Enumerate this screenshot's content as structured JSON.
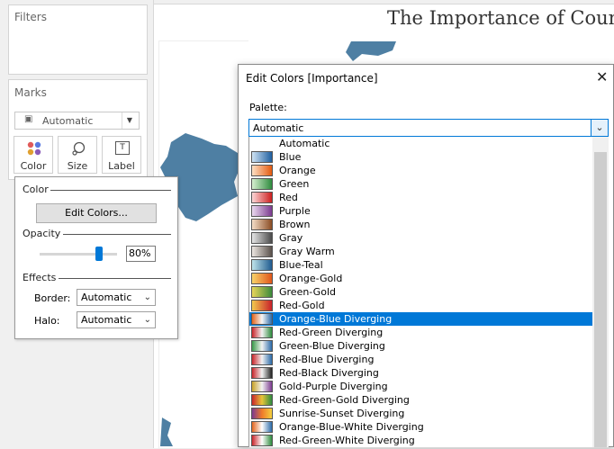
{
  "left_panel": {
    "filters_label": "Filters",
    "marks_label": "Marks",
    "mark_type": "Automatic",
    "mark_buttons": [
      {
        "label": "Color",
        "icon": "color-dots-icon"
      },
      {
        "label": "Size",
        "icon": "size-icon"
      },
      {
        "label": "Label",
        "icon": "label-icon"
      }
    ]
  },
  "canvas": {
    "title": "The Importance of Coun"
  },
  "color_popup": {
    "color_section": "Color",
    "edit_colors_button": "Edit Colors...",
    "opacity_section": "Opacity",
    "opacity_value": "80%",
    "opacity_fraction": 0.8,
    "effects_section": "Effects",
    "border_label": "Border:",
    "border_value": "Automatic",
    "halo_label": "Halo:",
    "halo_value": "Automatic"
  },
  "dialog": {
    "title": "Edit Colors [Importance]",
    "palette_label": "Palette:",
    "palette_value": "Automatic",
    "selected_index": 13,
    "palettes": [
      {
        "name": "Automatic",
        "colors": []
      },
      {
        "name": "Blue",
        "colors": [
          "#cfe3f4",
          "#1f5fa0"
        ]
      },
      {
        "name": "Orange",
        "colors": [
          "#fde0c5",
          "#e35a0f"
        ]
      },
      {
        "name": "Green",
        "colors": [
          "#d6efd0",
          "#2e8b3e"
        ]
      },
      {
        "name": "Red",
        "colors": [
          "#fcd7d7",
          "#cc1f1f"
        ]
      },
      {
        "name": "Purple",
        "colors": [
          "#ead9ef",
          "#7b3a8f"
        ]
      },
      {
        "name": "Brown",
        "colors": [
          "#f3dcc6",
          "#8a4c24"
        ]
      },
      {
        "name": "Gray",
        "colors": [
          "#e6e6e6",
          "#4a4a4a"
        ]
      },
      {
        "name": "Gray Warm",
        "colors": [
          "#ece6e1",
          "#5a514b"
        ]
      },
      {
        "name": "Blue-Teal",
        "colors": [
          "#bfe3ea",
          "#1f5b8f"
        ]
      },
      {
        "name": "Orange-Gold",
        "colors": [
          "#f8d36a",
          "#e0561a"
        ]
      },
      {
        "name": "Green-Gold",
        "colors": [
          "#e8d65a",
          "#3a8a3a"
        ]
      },
      {
        "name": "Red-Gold",
        "colors": [
          "#f2c94c",
          "#c8202a"
        ]
      },
      {
        "name": "Orange-Blue Diverging",
        "colors": [
          "#e3651d",
          "#f6f6f6",
          "#2b6aa8"
        ]
      },
      {
        "name": "Red-Green Diverging",
        "colors": [
          "#c8252a",
          "#f2f2f2",
          "#2e8b3e"
        ]
      },
      {
        "name": "Green-Blue Diverging",
        "colors": [
          "#3a9a4a",
          "#f2f2f2",
          "#2b6aa8"
        ]
      },
      {
        "name": "Red-Blue Diverging",
        "colors": [
          "#c8252a",
          "#f2f2f2",
          "#2b6aa8"
        ]
      },
      {
        "name": "Red-Black Diverging",
        "colors": [
          "#c8252a",
          "#f2f2f2",
          "#222222"
        ]
      },
      {
        "name": "Gold-Purple Diverging",
        "colors": [
          "#c9a227",
          "#f2f2f2",
          "#7b3a8f"
        ]
      },
      {
        "name": "Red-Green-Gold Diverging",
        "colors": [
          "#c8252a",
          "#e8c53a",
          "#2e8b3e"
        ]
      },
      {
        "name": "Sunrise-Sunset Diverging",
        "colors": [
          "#7b3a8f",
          "#f07a2a",
          "#f4d03f"
        ]
      },
      {
        "name": "Orange-Blue-White Diverging",
        "colors": [
          "#e3651d",
          "#ffffff",
          "#2b6aa8"
        ]
      },
      {
        "name": "Red-Green-White Diverging",
        "colors": [
          "#c8252a",
          "#ffffff",
          "#2e8b3e"
        ]
      }
    ]
  }
}
